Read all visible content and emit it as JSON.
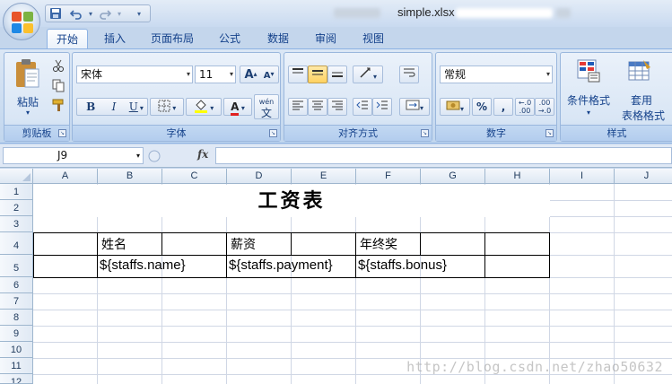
{
  "window": {
    "doc_title": "simple.xlsx"
  },
  "quick_access": {
    "save_icon": "save-icon",
    "undo_icon": "undo-icon",
    "redo_icon": "redo-icon",
    "customize_glyph": "▾"
  },
  "tabs": [
    {
      "label": "开始",
      "active": true
    },
    {
      "label": "插入"
    },
    {
      "label": "页面布局"
    },
    {
      "label": "公式"
    },
    {
      "label": "数据"
    },
    {
      "label": "审阅"
    },
    {
      "label": "视图"
    }
  ],
  "ribbon": {
    "clipboard": {
      "paste_label": "粘贴",
      "group_label": "剪贴板"
    },
    "font": {
      "font_name": "宋体",
      "font_size": "11",
      "grow_label": "A",
      "shrink_label": "A",
      "bold": "B",
      "italic": "I",
      "underline": "U",
      "font_color": "A",
      "phonetic": "wén",
      "phonetic_char": "文",
      "group_label": "字体"
    },
    "alignment": {
      "group_label": "对齐方式"
    },
    "number": {
      "format": "常规",
      "percent": "%",
      "comma": ",",
      "group_label": "数字"
    },
    "styles": {
      "conditional_format": "条件格式",
      "table_format_line1": "套用",
      "table_format_line2": "表格格式",
      "group_label": "样式"
    }
  },
  "formula_bar": {
    "name_box": "J9",
    "fx": "fx",
    "formula": ""
  },
  "columns": [
    "A",
    "B",
    "C",
    "D",
    "E",
    "F",
    "G",
    "H",
    "I",
    "J"
  ],
  "rows": [
    "1",
    "2",
    "3",
    "4",
    "5",
    "6",
    "7",
    "8",
    "9",
    "10",
    "11",
    "12"
  ],
  "sheet": {
    "title": "工资表",
    "header_name": "姓名",
    "header_payment": "薪资",
    "header_bonus": "年终奖",
    "cell_name": "${staffs.name}",
    "cell_payment": "${staffs.payment}",
    "cell_bonus": "${staffs.bonus}"
  },
  "watermark": "http://blog.csdn.net/zhao50632"
}
